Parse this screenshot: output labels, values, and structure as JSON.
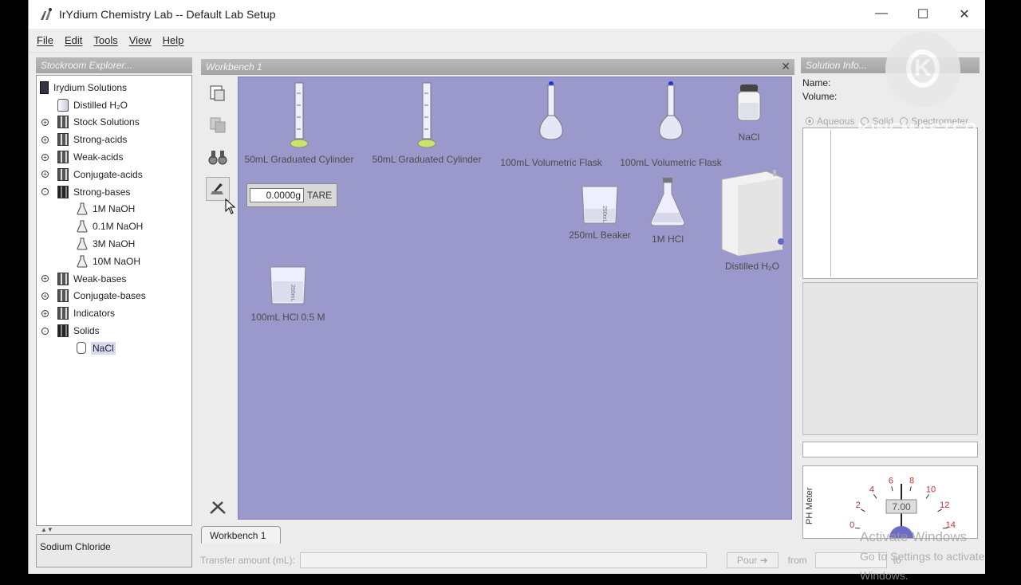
{
  "window": {
    "title": "IrYdium Chemistry Lab -- Default Lab Setup",
    "controls": [
      "—",
      "☐",
      "✕"
    ]
  },
  "menu": [
    "File",
    "Edit",
    "Tools",
    "View",
    "Help"
  ],
  "stockroom": {
    "header": "Stockroom Explorer...",
    "tree": [
      {
        "label": "Irydium Solutions",
        "icon": "book-icon",
        "level": 0
      },
      {
        "label": "Distilled H₂O",
        "icon": "bottle-icon",
        "level": 1
      },
      {
        "label": "Stock Solutions",
        "icon": "shelf-icon",
        "level": 1,
        "toggle": "+"
      },
      {
        "label": "Strong-acids",
        "icon": "shelf-icon",
        "level": 1,
        "toggle": "+"
      },
      {
        "label": "Weak-acids",
        "icon": "shelf-icon",
        "level": 1,
        "toggle": "+"
      },
      {
        "label": "Conjugate-acids",
        "icon": "shelf-icon",
        "level": 1,
        "toggle": "+"
      },
      {
        "label": "Strong-bases",
        "icon": "shelf-icon",
        "level": 1,
        "toggle": "-",
        "dark": true
      },
      {
        "label": "1M NaOH",
        "icon": "flask-icon",
        "level": 2
      },
      {
        "label": "0.1M NaOH",
        "icon": "flask-icon",
        "level": 2
      },
      {
        "label": "3M NaOH",
        "icon": "flask-icon",
        "level": 2
      },
      {
        "label": "10M NaOH",
        "icon": "flask-icon",
        "level": 2
      },
      {
        "label": "Weak-bases",
        "icon": "shelf-icon",
        "level": 1,
        "toggle": "+"
      },
      {
        "label": "Conjugate-bases",
        "icon": "shelf-icon",
        "level": 1,
        "toggle": "+"
      },
      {
        "label": "Indicators",
        "icon": "shelf-icon",
        "level": 1,
        "toggle": "+"
      },
      {
        "label": "Solids",
        "icon": "shelf-icon",
        "level": 1,
        "toggle": "-",
        "dark": true
      },
      {
        "label": "NaCl",
        "icon": "jar-icon",
        "level": 2,
        "selected": true
      }
    ],
    "splitter_arrows": "▲▼",
    "description": "Sodium Chloride"
  },
  "workbench": {
    "header": "Workbench 1",
    "tab": "Workbench 1",
    "balance": {
      "reading": "0.0000g",
      "tare": "TARE"
    },
    "items": [
      {
        "id": "cyl1",
        "label": "50mL Graduated Cylinder"
      },
      {
        "id": "cyl2",
        "label": "50mL Graduated Cylinder"
      },
      {
        "id": "vf1",
        "label": "100mL Volumetric Flask"
      },
      {
        "id": "vf2",
        "label": "100mL Volumetric Flask"
      },
      {
        "id": "nacl",
        "label": "NaCl"
      },
      {
        "id": "beaker",
        "label": "250mL Beaker"
      },
      {
        "id": "hcl",
        "label": "1M HCl"
      },
      {
        "id": "water",
        "label": "Distilled H₂O"
      },
      {
        "id": "beaker2",
        "label": "100mL HCl 0.5 M"
      }
    ]
  },
  "solution_info": {
    "header": "Solution Info...",
    "name_label": "Name:",
    "volume_label": "Volume:",
    "views": [
      "Aqueous",
      "Solid",
      "Spectrometer"
    ],
    "ph_meter_label": "PH Meter",
    "ph_reading": "7.00",
    "ph_ticks": [
      "0",
      "2",
      "4",
      "6",
      "8",
      "10",
      "12",
      "14"
    ]
  },
  "bottom_bar": {
    "transfer_label": "Transfer amount (mL):",
    "pour_label": "Pour",
    "from_label": "from",
    "to_label": "to"
  },
  "overlays": {
    "watermark": "KINEMASTER",
    "activate_line1": "Activate Windows",
    "activate_line2": "Go to Settings to activate Windows."
  },
  "colors": {
    "bench": "#9b99cc",
    "panel_header": "#aaaaaa",
    "selection": "#d8d8f0"
  }
}
